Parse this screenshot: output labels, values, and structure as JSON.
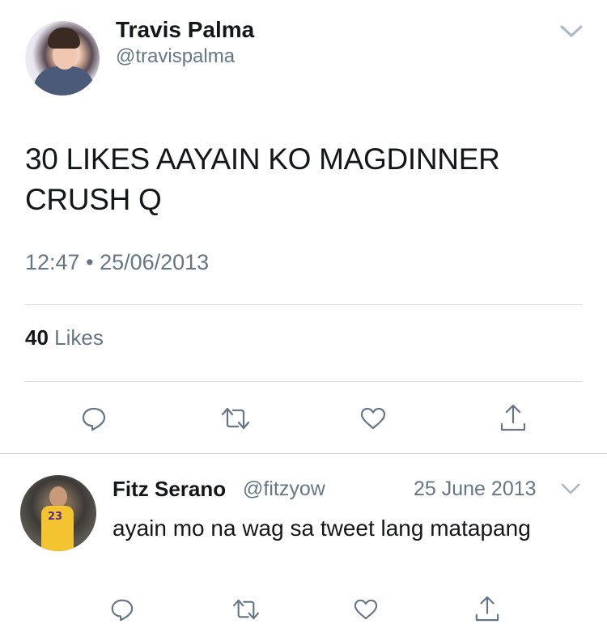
{
  "tweet": {
    "author_name": "Travis Palma",
    "author_handle": "@travispalma",
    "text": "30 LIKES AAYAIN KO MAGDINNER CRUSH Q",
    "time": "12:47",
    "separator": "•",
    "date": "25/06/2013",
    "likes_count": "40",
    "likes_label": "Likes",
    "actions": [
      "reply-icon",
      "retweet-icon",
      "like-icon",
      "share-icon"
    ]
  },
  "reply": {
    "author_name": "Fitz Serano",
    "author_handle": "@fitzyow",
    "date": "25 June 2013",
    "text": "ayain mo na wag sa tweet lang matapang",
    "avatar_jersey_number": "23",
    "actions": [
      "reply-icon",
      "retweet-icon",
      "like-icon",
      "share-icon"
    ]
  },
  "colors": {
    "primary_text": "#14171a",
    "secondary_text": "#657786",
    "divider": "#d5dade",
    "icon": "#657786"
  }
}
